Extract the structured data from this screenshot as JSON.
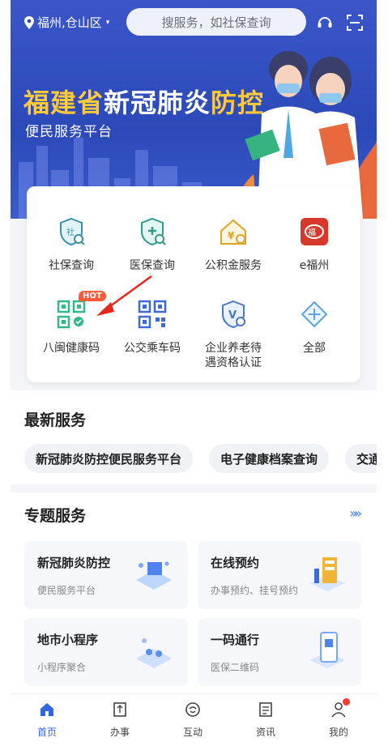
{
  "colors": {
    "banner": "#2c49b8",
    "accent": "#2f66e0",
    "title_yellow": "#ffc93c",
    "hot": "#ff5a3c"
  },
  "location": {
    "text": "福州,仓山区",
    "icon": "location-pin-icon"
  },
  "search": {
    "placeholder": "搜服务，如社保查询"
  },
  "banner": {
    "title_part1": "福建省",
    "title_part2": "新冠肺炎",
    "title_part3": "防控",
    "subtitle": "便民服务平台"
  },
  "services": [
    {
      "label": "社保查询",
      "icon": "social-security-shield-icon"
    },
    {
      "label": "医保查询",
      "icon": "medical-insurance-shield-icon"
    },
    {
      "label": "公积金服务",
      "icon": "housing-fund-icon"
    },
    {
      "label": "e福州",
      "icon": "e-fuzhou-logo-icon"
    },
    {
      "label": "八闽健康码",
      "icon": "health-code-qr-icon",
      "badge": "HOT"
    },
    {
      "label": "公交乘车码",
      "icon": "bus-qr-code-icon"
    },
    {
      "label_line1": "企业养老待",
      "label_line2": "遇资格认证",
      "icon": "pension-certification-icon"
    },
    {
      "label": "全部",
      "icon": "all-services-icon"
    }
  ],
  "latest": {
    "title": "最新服务",
    "chips": [
      "新冠肺炎防控便民服务平台",
      "电子健康档案查询",
      "交通"
    ]
  },
  "topic": {
    "title": "专题服务",
    "more": "»»",
    "cards": [
      {
        "title": "新冠肺炎防控",
        "desc": "便民服务平台"
      },
      {
        "title": "在线预约",
        "desc": "办事预约、挂号预约"
      },
      {
        "title": "地市小程序",
        "desc": "小程序聚合"
      },
      {
        "title": "一码通行",
        "desc": "医保二维码"
      }
    ]
  },
  "nav": [
    {
      "label": "首页",
      "icon": "home-icon",
      "active": true
    },
    {
      "label": "办事",
      "icon": "tasks-icon"
    },
    {
      "label": "互动",
      "icon": "interaction-icon"
    },
    {
      "label": "资讯",
      "icon": "news-icon"
    },
    {
      "label": "我的",
      "icon": "profile-icon",
      "dot": true
    }
  ]
}
